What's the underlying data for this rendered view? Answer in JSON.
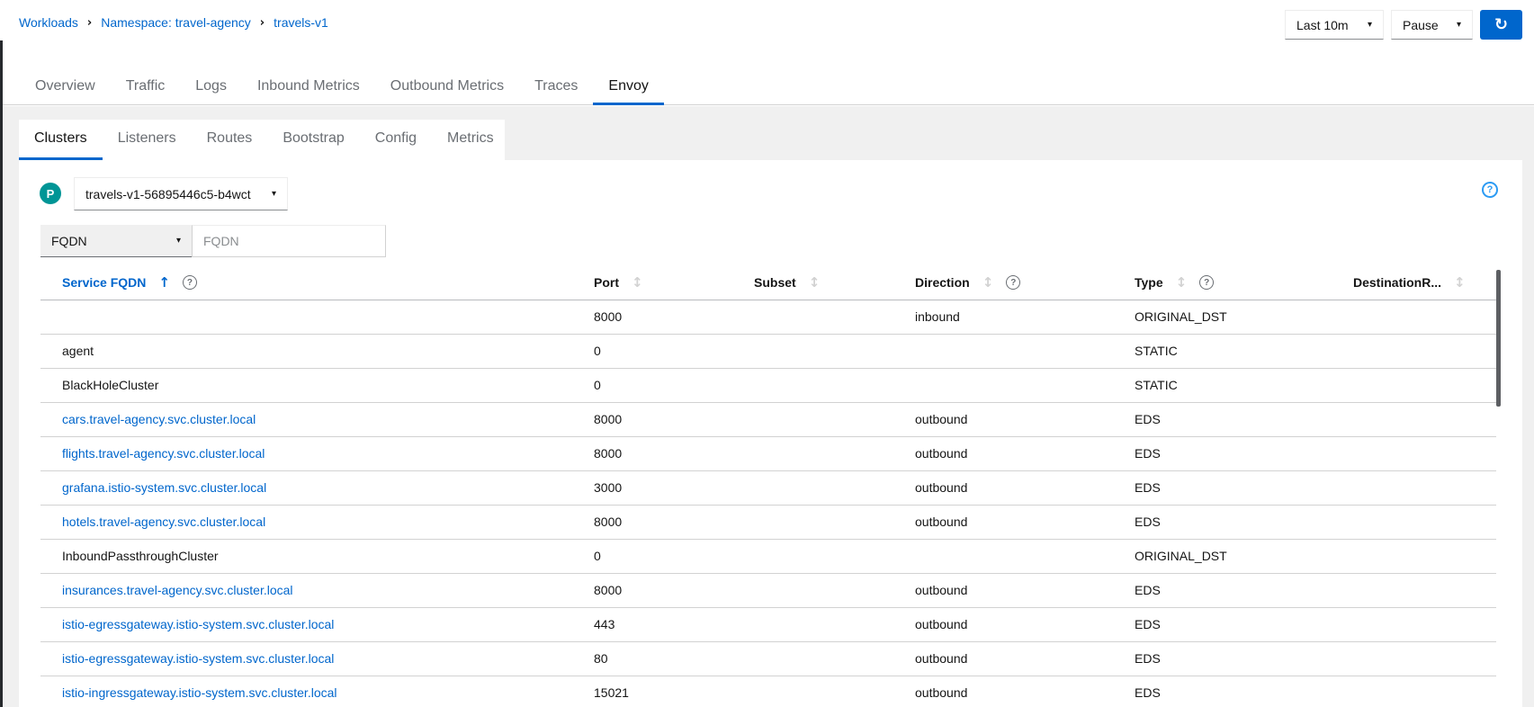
{
  "breadcrumb": {
    "items": [
      "Workloads",
      "Namespace: travel-agency",
      "travels-v1"
    ]
  },
  "toolbar": {
    "duration_label": "Last 10m",
    "refresh_mode_label": "Pause"
  },
  "tabs": {
    "items": [
      "Overview",
      "Traffic",
      "Logs",
      "Inbound Metrics",
      "Outbound Metrics",
      "Traces",
      "Envoy"
    ],
    "active": "Envoy"
  },
  "subtabs": {
    "items": [
      "Clusters",
      "Listeners",
      "Routes",
      "Bootstrap",
      "Config",
      "Metrics"
    ],
    "active": "Clusters"
  },
  "pod_selector": {
    "badge": "P",
    "value": "travels-v1-56895446c5-b4wct"
  },
  "filter": {
    "type_value": "FQDN",
    "input_placeholder": "FQDN",
    "input_value": ""
  },
  "table": {
    "columns": [
      {
        "label": "Service FQDN",
        "sortable": true,
        "sorted": "asc",
        "help": true
      },
      {
        "label": "Port",
        "sortable": true,
        "sorted": null,
        "help": false
      },
      {
        "label": "Subset",
        "sortable": true,
        "sorted": null,
        "help": false
      },
      {
        "label": "Direction",
        "sortable": true,
        "sorted": null,
        "help": true
      },
      {
        "label": "Type",
        "sortable": true,
        "sorted": null,
        "help": true
      },
      {
        "label": "DestinationR...",
        "sortable": true,
        "sorted": null,
        "help": false
      }
    ],
    "rows": [
      {
        "service_fqdn": "",
        "is_link": false,
        "port": "8000",
        "subset": "",
        "direction": "inbound",
        "type": "ORIGINAL_DST",
        "destination_rule": ""
      },
      {
        "service_fqdn": "agent",
        "is_link": false,
        "port": "0",
        "subset": "",
        "direction": "",
        "type": "STATIC",
        "destination_rule": ""
      },
      {
        "service_fqdn": "BlackHoleCluster",
        "is_link": false,
        "port": "0",
        "subset": "",
        "direction": "",
        "type": "STATIC",
        "destination_rule": ""
      },
      {
        "service_fqdn": "cars.travel-agency.svc.cluster.local",
        "is_link": true,
        "port": "8000",
        "subset": "",
        "direction": "outbound",
        "type": "EDS",
        "destination_rule": ""
      },
      {
        "service_fqdn": "flights.travel-agency.svc.cluster.local",
        "is_link": true,
        "port": "8000",
        "subset": "",
        "direction": "outbound",
        "type": "EDS",
        "destination_rule": ""
      },
      {
        "service_fqdn": "grafana.istio-system.svc.cluster.local",
        "is_link": true,
        "port": "3000",
        "subset": "",
        "direction": "outbound",
        "type": "EDS",
        "destination_rule": ""
      },
      {
        "service_fqdn": "hotels.travel-agency.svc.cluster.local",
        "is_link": true,
        "port": "8000",
        "subset": "",
        "direction": "outbound",
        "type": "EDS",
        "destination_rule": ""
      },
      {
        "service_fqdn": "InboundPassthroughCluster",
        "is_link": false,
        "port": "0",
        "subset": "",
        "direction": "",
        "type": "ORIGINAL_DST",
        "destination_rule": ""
      },
      {
        "service_fqdn": "insurances.travel-agency.svc.cluster.local",
        "is_link": true,
        "port": "8000",
        "subset": "",
        "direction": "outbound",
        "type": "EDS",
        "destination_rule": ""
      },
      {
        "service_fqdn": "istio-egressgateway.istio-system.svc.cluster.local",
        "is_link": true,
        "port": "443",
        "subset": "",
        "direction": "outbound",
        "type": "EDS",
        "destination_rule": ""
      },
      {
        "service_fqdn": "istio-egressgateway.istio-system.svc.cluster.local",
        "is_link": true,
        "port": "80",
        "subset": "",
        "direction": "outbound",
        "type": "EDS",
        "destination_rule": ""
      },
      {
        "service_fqdn": "istio-ingressgateway.istio-system.svc.cluster.local",
        "is_link": true,
        "port": "15021",
        "subset": "",
        "direction": "outbound",
        "type": "EDS",
        "destination_rule": ""
      }
    ]
  },
  "icons": {
    "breadcrumb_separator": "›",
    "caret_down": "▾",
    "sync": "↻",
    "sort_unsorted": "↕",
    "sort_ascending": "↑",
    "question_circle": "?"
  },
  "colors": {
    "accent_blue": "#0066cc",
    "link_blue": "#0066cc",
    "pod_badge_teal": "#009596",
    "help_icon_blue": "#2b9af3",
    "refresh_button_blue": "#0066cc",
    "page_background_gray": "#f0f0f0"
  }
}
